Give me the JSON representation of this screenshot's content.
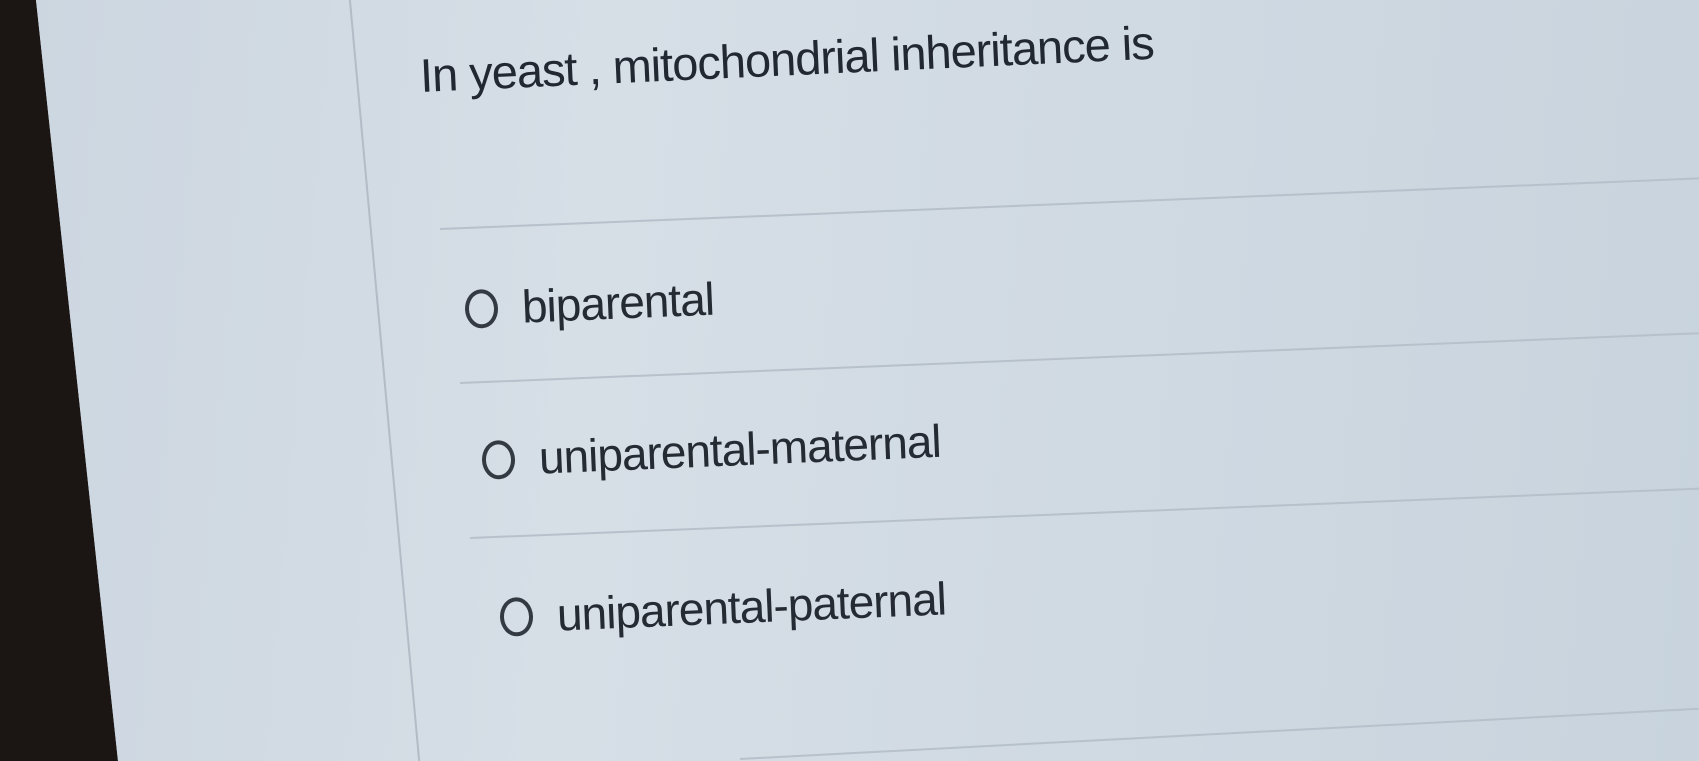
{
  "question": {
    "text": "In yeast , mitochondrial inheritance is"
  },
  "options": [
    {
      "label": "biparental",
      "selected": false
    },
    {
      "label": "uniparental-maternal",
      "selected": false
    },
    {
      "label": "uniparental-paternal",
      "selected": false
    }
  ],
  "colors": {
    "text": "#222831",
    "divider": "#b7c1cb",
    "background": "#d3dce4",
    "bezel": "#1b1614"
  }
}
